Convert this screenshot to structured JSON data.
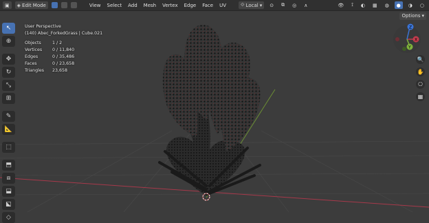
{
  "header": {
    "mode_label": "Edit Mode",
    "menus": [
      "View",
      "Select",
      "Add",
      "Mesh",
      "Vertex",
      "Edge",
      "Face",
      "UV"
    ],
    "transform_orientation": "Local",
    "options_label": "Options"
  },
  "overlay": {
    "view_name": "User Perspective",
    "object_info": "(140) Abec_ForkedGrass | Cube.021",
    "stats": [
      {
        "label": "Objects",
        "value": "1 / 2"
      },
      {
        "label": "Vertices",
        "value": "0 / 11,840"
      },
      {
        "label": "Edges",
        "value": "0 / 35,486"
      },
      {
        "label": "Faces",
        "value": "0 / 23,658"
      },
      {
        "label": "Triangles",
        "value": "23,658"
      }
    ]
  },
  "gizmo": {
    "x": "X",
    "y": "Y",
    "z": "Z"
  },
  "colors": {
    "accent": "#4772b3",
    "axis_x": "#c43c4e",
    "axis_y": "#7fb33c",
    "axis_z": "#3b74d6"
  }
}
